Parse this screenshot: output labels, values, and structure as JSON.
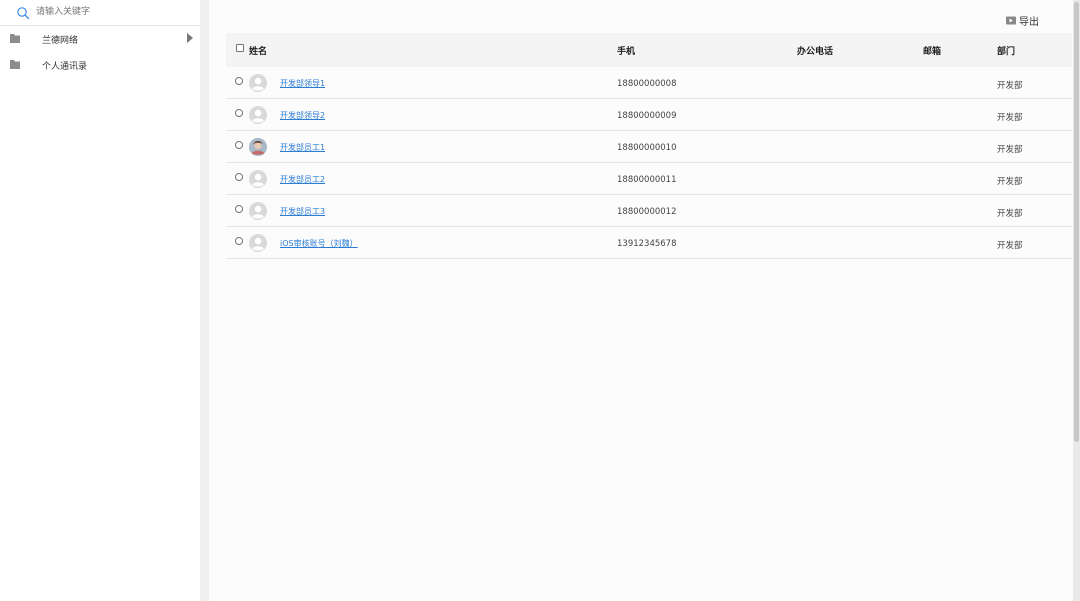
{
  "sidebar": {
    "search": {
      "placeholder": "请输入关键字",
      "value": ""
    },
    "items": [
      {
        "label": "兰德网络",
        "icon": "folder-icon",
        "expandable": true
      },
      {
        "label": "个人通讯录",
        "icon": "folder-icon",
        "expandable": false
      }
    ]
  },
  "toolbar": {
    "export_label": "导出",
    "export_icon": "export-icon"
  },
  "table": {
    "columns": {
      "name": "姓名",
      "mobile": "手机",
      "office_phone": "办公电话",
      "email": "邮箱",
      "department": "部门"
    },
    "rows": [
      {
        "name": "开发部领导1",
        "mobile": "18800000008",
        "office_phone": "",
        "email": "",
        "department": "开发部",
        "avatar": "default-avatar"
      },
      {
        "name": "开发部领导2",
        "mobile": "18800000009",
        "office_phone": "",
        "email": "",
        "department": "开发部",
        "avatar": "default-avatar"
      },
      {
        "name": "开发部员工1",
        "mobile": "18800000010",
        "office_phone": "",
        "email": "",
        "department": "开发部",
        "avatar": "photo-avatar"
      },
      {
        "name": "开发部员工2",
        "mobile": "18800000011",
        "office_phone": "",
        "email": "",
        "department": "开发部",
        "avatar": "default-avatar"
      },
      {
        "name": "开发部员工3",
        "mobile": "18800000012",
        "office_phone": "",
        "email": "",
        "department": "开发部",
        "avatar": "default-avatar"
      },
      {
        "name": "iOS审核账号（刘魏）",
        "mobile": "13912345678",
        "office_phone": "",
        "email": "",
        "department": "开发部",
        "avatar": "default-avatar"
      }
    ]
  },
  "colors": {
    "link": "#2b7cd3",
    "header_bg": "#f4f4f4",
    "sidebar_bg": "#ffffff",
    "main_bg": "#fcfcfc"
  }
}
